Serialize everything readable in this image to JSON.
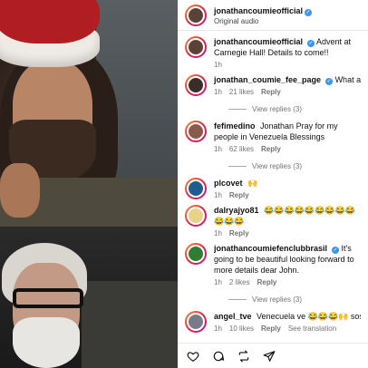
{
  "header": {
    "username": "jonathancoumieofficial",
    "subtitle": "Original audio"
  },
  "comments": [
    {
      "username": "jonathancoumieofficial",
      "text": "Advent at Carnegie Hall! Details to come!!",
      "time": "1h",
      "likes": "",
      "verified": true,
      "view_replies": ""
    },
    {
      "username": "jonathan_coumie_fee_page",
      "text": "What a wonderful",
      "time": "1h",
      "likes": "21 likes",
      "reply": "Reply",
      "verified": true,
      "view_replies": "View replies (3)"
    },
    {
      "username": "fefimedino",
      "text": "Jonathan Pray for my people in Venezuela Blessings",
      "time": "1h",
      "likes": "62 likes",
      "reply": "Reply",
      "verified": false,
      "view_replies": "View replies (3)"
    },
    {
      "username": "plcovet",
      "text": "🙌",
      "time": "1h",
      "likes": "",
      "reply": "Reply",
      "verified": false,
      "view_replies": ""
    },
    {
      "username": "dalryajyo81",
      "text": "😂😂😂😂😂😂😂😂😂😂😂😂",
      "time": "1h",
      "likes": "",
      "reply": "Reply",
      "verified": false,
      "view_replies": ""
    },
    {
      "username": "jonathancoumiefenclubbrasil",
      "text": "It's going to be beautiful looking forward to more details dear John.",
      "time": "1h",
      "likes": "2 likes",
      "reply": "Reply",
      "verified": true,
      "view_replies": "View replies (3)"
    },
    {
      "username": "angel_tve",
      "text": "Venecuela ve 😂😂😂🙌 sos",
      "time": "1h",
      "likes": "10 likes",
      "reply": "Reply",
      "extra": "See translation",
      "verified": false,
      "view_replies": ""
    }
  ],
  "actions": [
    "heart-icon",
    "comment-icon",
    "repost-icon",
    "share-icon"
  ],
  "colors": {
    "verified": "#3897f0",
    "meta": "#737373",
    "hat": "#b01e23"
  }
}
